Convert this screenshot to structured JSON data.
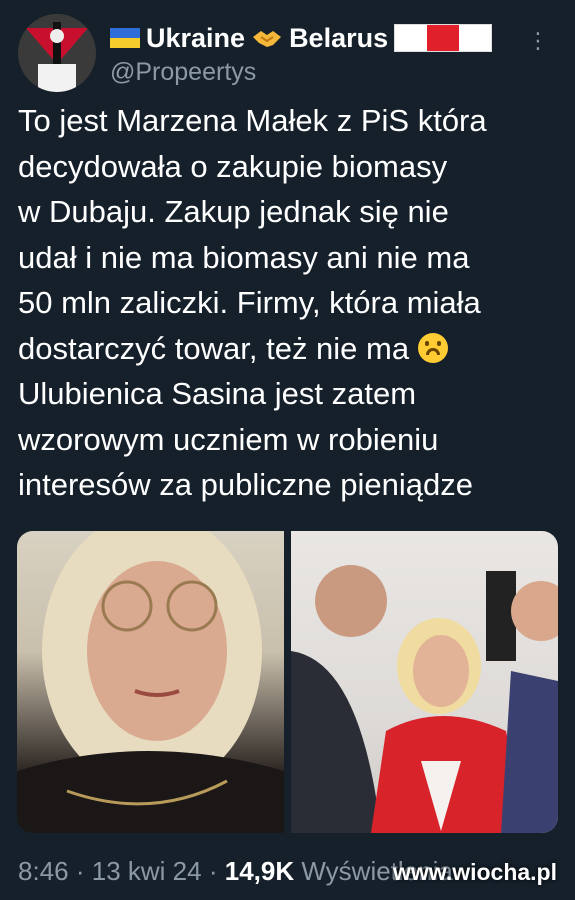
{
  "header": {
    "display_name_part1": "Ukraine",
    "display_name_part2": "Belarus",
    "handle": "@Propeertys",
    "more_icon": "⋮"
  },
  "tweet": {
    "text": "To jest Marzena Małek z PiS która\ndecydowała o zakupie biomasy\nw Dubaju. Zakup jednak się nie\nudał i nie ma biomasy ani nie ma\n50 mln zaliczki. Firmy, która miała\ndostarczyć towar, też nie ma ",
    "text_after_emoji": "\nUlubienica Sasina jest zatem\nwzorowym uczniem w robieniu\ninteresów za publiczne pieniądze"
  },
  "footer": {
    "time": "8:46",
    "date": "13 kwi 24",
    "views_count": "14,9K",
    "views_label": "Wyświetlenia",
    "separator": "·"
  },
  "watermark": "www.wiocha.pl",
  "colors": {
    "background": "#15202b",
    "text": "#ffffff",
    "muted": "#8b98a5"
  }
}
